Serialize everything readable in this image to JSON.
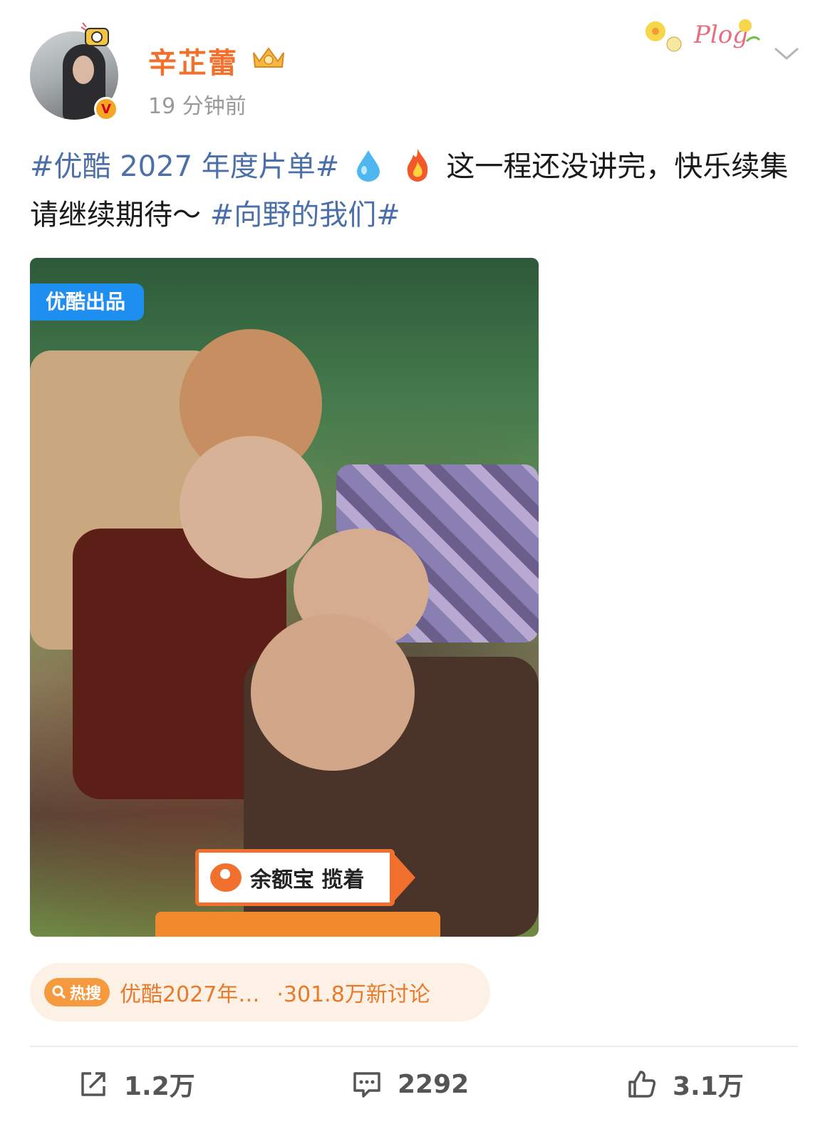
{
  "post": {
    "author": "辛芷蕾",
    "time": "19 分钟前",
    "text_hashtag_1": "#优酷 2027 年度片单#",
    "text_body": "这一程还没讲完，快乐续集请继续期待～",
    "text_hashtag_2": "#向野的我们#"
  },
  "image": {
    "badge": "优酷出品",
    "sponsor": "余额宝 揽着"
  },
  "trend": {
    "badge": "热搜",
    "title": "优酷2027年…",
    "count": "·301.8万新讨论"
  },
  "actions": {
    "share_count": "1.2万",
    "comment_count": "2292",
    "like_count": "3.1万"
  },
  "colors": {
    "name": "#f2702d",
    "hashtag": "#4b6fa8",
    "trend": "#e97a2c",
    "hot_badge": "#f59a3e",
    "image_badge": "#1f8ef1"
  },
  "icons": [
    "avatar-decoration-icon",
    "verified-badge-icon",
    "crown-level-icon",
    "plog-sticker-icon",
    "chevron-down-icon",
    "water-drop-icon",
    "fire-icon",
    "search-icon",
    "share-icon",
    "comment-icon",
    "like-icon"
  ]
}
